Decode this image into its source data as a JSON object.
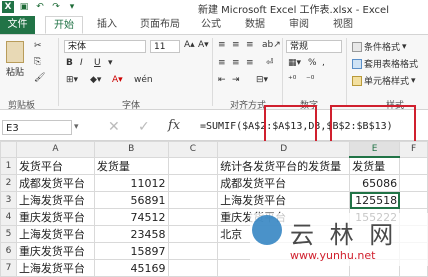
{
  "title_bar": {
    "title": "新建 Microsoft Excel 工作表.xlsx - Excel"
  },
  "tabs": [
    "文件",
    "开始",
    "插入",
    "页面布局",
    "公式",
    "数据",
    "审阅",
    "视图"
  ],
  "ribbon": {
    "clipboard": {
      "paste": "粘贴",
      "group_label": "剪贴板"
    },
    "font": {
      "name": "宋体",
      "size": "11",
      "bold": "B",
      "italic": "I",
      "underline": "U",
      "group_label": "字体",
      "wen": "wén"
    },
    "alignment": {
      "group_label": "对齐方式"
    },
    "number": {
      "format": "常规",
      "currency": "%",
      "group_label": "数字"
    },
    "styles": {
      "cond": "条件格式",
      "table": "套用表格格式",
      "cell": "单元格样式",
      "group_label": "样式"
    }
  },
  "formula_bar": {
    "name_box": "E3",
    "fx": "fx",
    "formula": "=SUMIF($A$2:$A$13,D3,$B$2:$B$13)"
  },
  "grid": {
    "columns": [
      "A",
      "B",
      "C",
      "D",
      "E",
      "F"
    ],
    "rows": [
      {
        "n": "1",
        "A": "发货平台",
        "B": "发货量",
        "C": "",
        "D": "统计各发货平台的发货量",
        "E": "发货量"
      },
      {
        "n": "2",
        "A": "成都发货平台",
        "B": "11012",
        "C": "",
        "D": "成都发货平台",
        "E": "65086"
      },
      {
        "n": "3",
        "A": "上海发货平台",
        "B": "56891",
        "C": "",
        "D": "上海发货平台",
        "E": "125518"
      },
      {
        "n": "4",
        "A": "重庆发货平台",
        "B": "74512",
        "C": "",
        "D": "重庆发货平台",
        "E": "155222"
      },
      {
        "n": "5",
        "A": "上海发货平台",
        "B": "23458",
        "C": "",
        "D": "北京",
        "E": ""
      },
      {
        "n": "6",
        "A": "重庆发货平台",
        "B": "15897",
        "C": "",
        "D": "",
        "E": ""
      },
      {
        "n": "7",
        "A": "上海发货平台",
        "B": "45169",
        "C": "",
        "D": "",
        "E": ""
      }
    ]
  },
  "watermark": {
    "text": "云 林 网",
    "url": "www.yunhu.net"
  },
  "colors": {
    "excel_green": "#217346",
    "highlight_red": "#d0202e"
  }
}
